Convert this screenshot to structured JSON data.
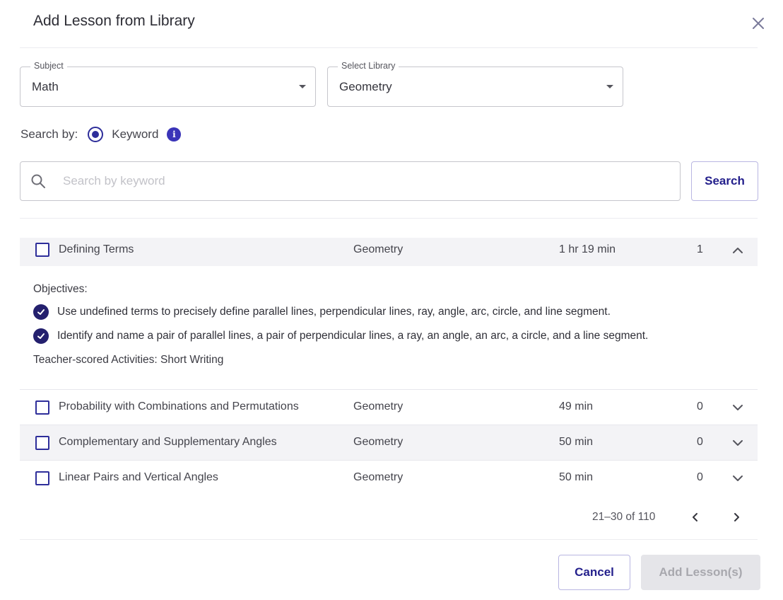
{
  "dialog": {
    "title": "Add Lesson from Library",
    "close_icon": "close-icon"
  },
  "filters": {
    "subject": {
      "label": "Subject",
      "value": "Math"
    },
    "library": {
      "label": "Select Library",
      "value": "Geometry"
    }
  },
  "search_by": {
    "label": "Search by:",
    "option": "Keyword",
    "selected": true
  },
  "search": {
    "placeholder": "Search by keyword",
    "value": "",
    "button_label": "Search"
  },
  "lessons": [
    {
      "name": "Defining Terms",
      "library": "Geometry",
      "duration": "1 hr 19 min",
      "count": "1",
      "expanded": true,
      "objectives_title": "Objectives:",
      "objectives": [
        "Use undefined terms to precisely define parallel lines, perpendicular lines, ray, angle, arc, circle, and line segment.",
        "Identify and name a pair of parallel lines, a pair of perpendicular lines, a ray, an angle, an arc, a circle, and a line segment."
      ],
      "activities": "Teacher-scored Activities: Short Writing"
    },
    {
      "name": "Probability with Combinations and Permutations",
      "library": "Geometry",
      "duration": "49 min",
      "count": "0",
      "expanded": false
    },
    {
      "name": "Complementary and Supplementary Angles",
      "library": "Geometry",
      "duration": "50 min",
      "count": "0",
      "expanded": false
    },
    {
      "name": "Linear Pairs and Vertical Angles",
      "library": "Geometry",
      "duration": "50 min",
      "count": "0",
      "expanded": false
    }
  ],
  "pagination": {
    "range_text": "21–30 of 110"
  },
  "footer": {
    "cancel_label": "Cancel",
    "add_label": "Add Lesson(s)",
    "add_disabled": true
  },
  "colors": {
    "accent": "#2e2e9a",
    "button_text": "#24208c",
    "disabled_bg": "#e5e5e9",
    "row_shade": "#f3f3f6"
  }
}
